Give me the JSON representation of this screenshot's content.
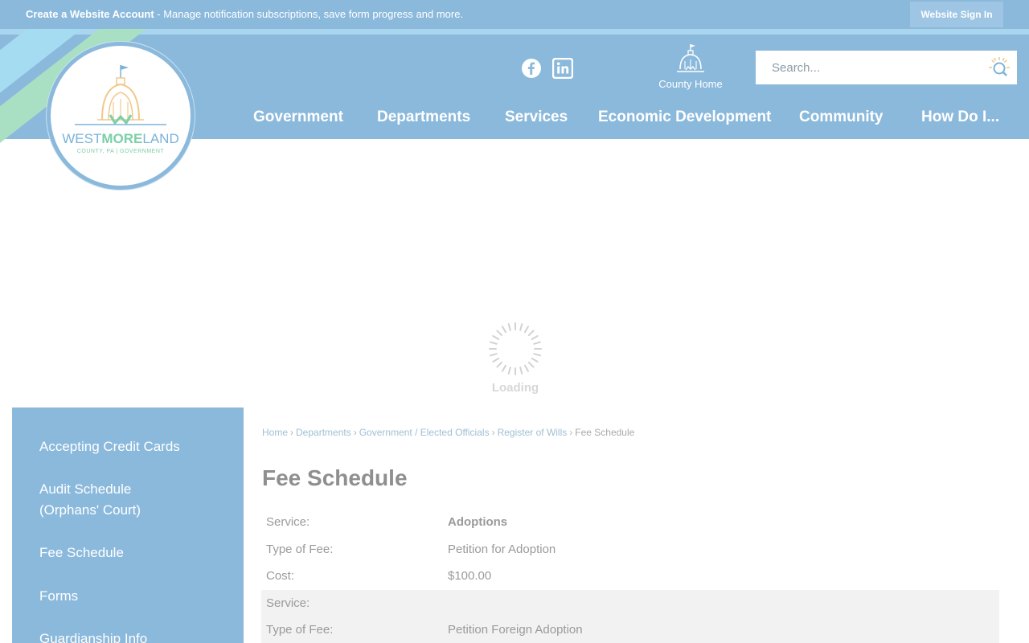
{
  "topbar": {
    "create_account_bold": "Create a Website Account",
    "create_account_rest": " - Manage notification subscriptions, save form progress and more.",
    "signin_label": "Website Sign In"
  },
  "logo": {
    "name_a": "WEST",
    "name_b": "MORE",
    "name_c": "LAND",
    "subtitle": "COUNTY, PA | GOVERNMENT"
  },
  "social": {
    "facebook_icon": "facebook-icon",
    "linkedin_icon": "linkedin-icon"
  },
  "county_home": {
    "label": "County Home",
    "icon": "capitol-dome-icon"
  },
  "search": {
    "placeholder": "Search...",
    "icon": "search-icon"
  },
  "nav": {
    "items": [
      "Government",
      "Departments",
      "Services",
      "Economic Development",
      "Community",
      "How Do I..."
    ]
  },
  "loading": {
    "label": "Loading"
  },
  "sidebar": {
    "items": [
      {
        "label": "Accepting Credit Cards"
      },
      {
        "label": "Audit Schedule (Orphans' Court)"
      },
      {
        "label": "Fee Schedule"
      },
      {
        "label": "Forms"
      },
      {
        "label": "Guardianship Info"
      }
    ]
  },
  "breadcrumb": {
    "items": [
      "Home",
      "Departments",
      "Government / Elected Officials",
      "Register of Wills"
    ],
    "current": "Fee Schedule",
    "separator": "›"
  },
  "main": {
    "title": "Fee Schedule",
    "rows": [
      {
        "key": "Service:",
        "value": "Adoptions"
      },
      {
        "key": "Type of Fee:",
        "value": "Petition for Adoption"
      },
      {
        "key": "Cost:",
        "value": "$100.00"
      },
      {
        "key": "Service:",
        "value": ""
      },
      {
        "key": "Type of Fee:",
        "value": "Petition Foreign Adoption"
      }
    ]
  },
  "colors": {
    "brand_blue": "#8bb9dc",
    "accent_green": "#7ccfa9",
    "light_blue": "#a6dcf1"
  }
}
